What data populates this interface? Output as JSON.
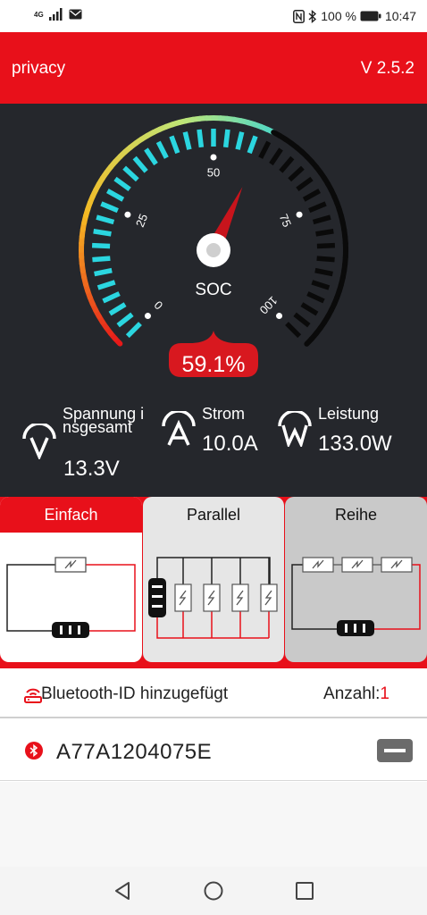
{
  "status_bar": {
    "network": "4G",
    "battery": "100 %",
    "time": "10:47",
    "icons": [
      "signal-icon",
      "mail-icon",
      "nfc-icon",
      "bluetooth-icon",
      "battery-icon"
    ]
  },
  "header": {
    "title": "privacy",
    "version": "V 2.5.2",
    "background": "#e8101a"
  },
  "gauge": {
    "label": "SOC",
    "ticks": [
      "0",
      "25",
      "50",
      "75",
      "100"
    ],
    "soc_value": 59.1,
    "percent_text": "59.1%"
  },
  "metrics": {
    "voltage": {
      "label": "Spannung insgesamt",
      "value": "13.3V",
      "icon": "voltage-icon"
    },
    "current": {
      "label": "Strom",
      "value": "10.0A",
      "icon": "current-icon"
    },
    "power": {
      "label": "Leistung",
      "value": "133.0W",
      "icon": "power-icon"
    }
  },
  "modes": {
    "single": "Einfach",
    "parallel": "Parallel",
    "series": "Reihe",
    "selected": "single"
  },
  "bluetooth": {
    "label": "Bluetooth-ID hinzugefügt",
    "count_label": "Anzahl:",
    "count": "1",
    "devices": [
      {
        "id": "A77A1204075E"
      }
    ]
  },
  "colors": {
    "accent": "#e8101a",
    "dark_bg": "#25272c",
    "gauge_active": "#2bd6e0"
  }
}
